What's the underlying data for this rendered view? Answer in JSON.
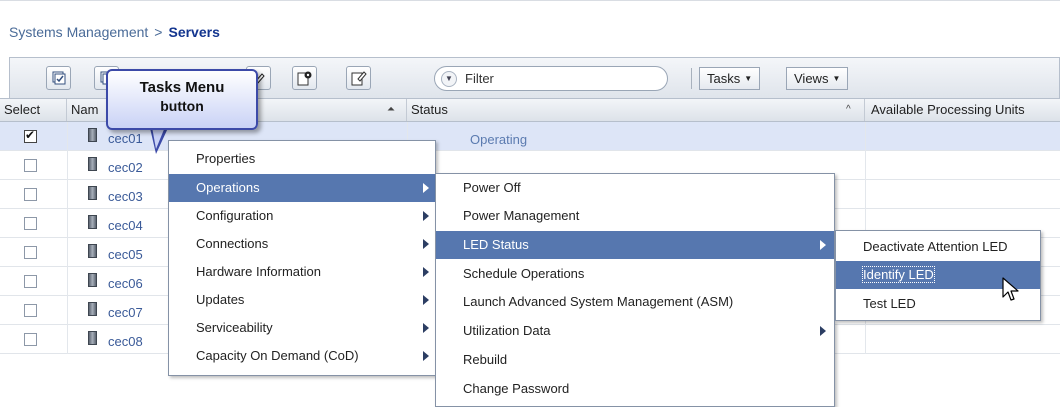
{
  "breadcrumb": {
    "parent": "Systems Management",
    "separator": ">",
    "current": "Servers"
  },
  "toolbar": {
    "filter_placeholder": "Filter",
    "tasks_label": "Tasks",
    "views_label": "Views"
  },
  "callout": {
    "line1": "Tasks Menu",
    "line2": "button"
  },
  "table": {
    "headers": {
      "select": "Select",
      "name": "Nam",
      "status": "Status",
      "procunits": "Available Processing Units"
    },
    "rows": [
      {
        "name": "cec01",
        "checked": true,
        "status": "Operating"
      },
      {
        "name": "cec02",
        "checked": false,
        "status": ""
      },
      {
        "name": "cec03",
        "checked": false,
        "status": ""
      },
      {
        "name": "cec04",
        "checked": false,
        "status": ""
      },
      {
        "name": "cec05",
        "checked": false,
        "status": ""
      },
      {
        "name": "cec06",
        "checked": false,
        "status": ""
      },
      {
        "name": "cec07",
        "checked": false,
        "status": ""
      },
      {
        "name": "cec08",
        "checked": false,
        "status": ""
      }
    ]
  },
  "menu1": {
    "items": [
      "Properties",
      "Operations",
      "Configuration",
      "Connections",
      "Hardware Information",
      "Updates",
      "Serviceability",
      "Capacity On Demand (CoD)"
    ]
  },
  "menu2": {
    "items": [
      "Power Off",
      "Power Management",
      "LED Status",
      "Schedule Operations",
      "Launch Advanced System Management (ASM)",
      "Utilization Data",
      "Rebuild",
      "Change Password"
    ]
  },
  "menu3": {
    "items": [
      "Deactivate Attention LED",
      "Identify LED",
      "Test LED"
    ]
  },
  "colors": {
    "highlight": "#5677af",
    "breadcrumb_current": "#13358f",
    "callout_border": "#3c4aa8"
  }
}
